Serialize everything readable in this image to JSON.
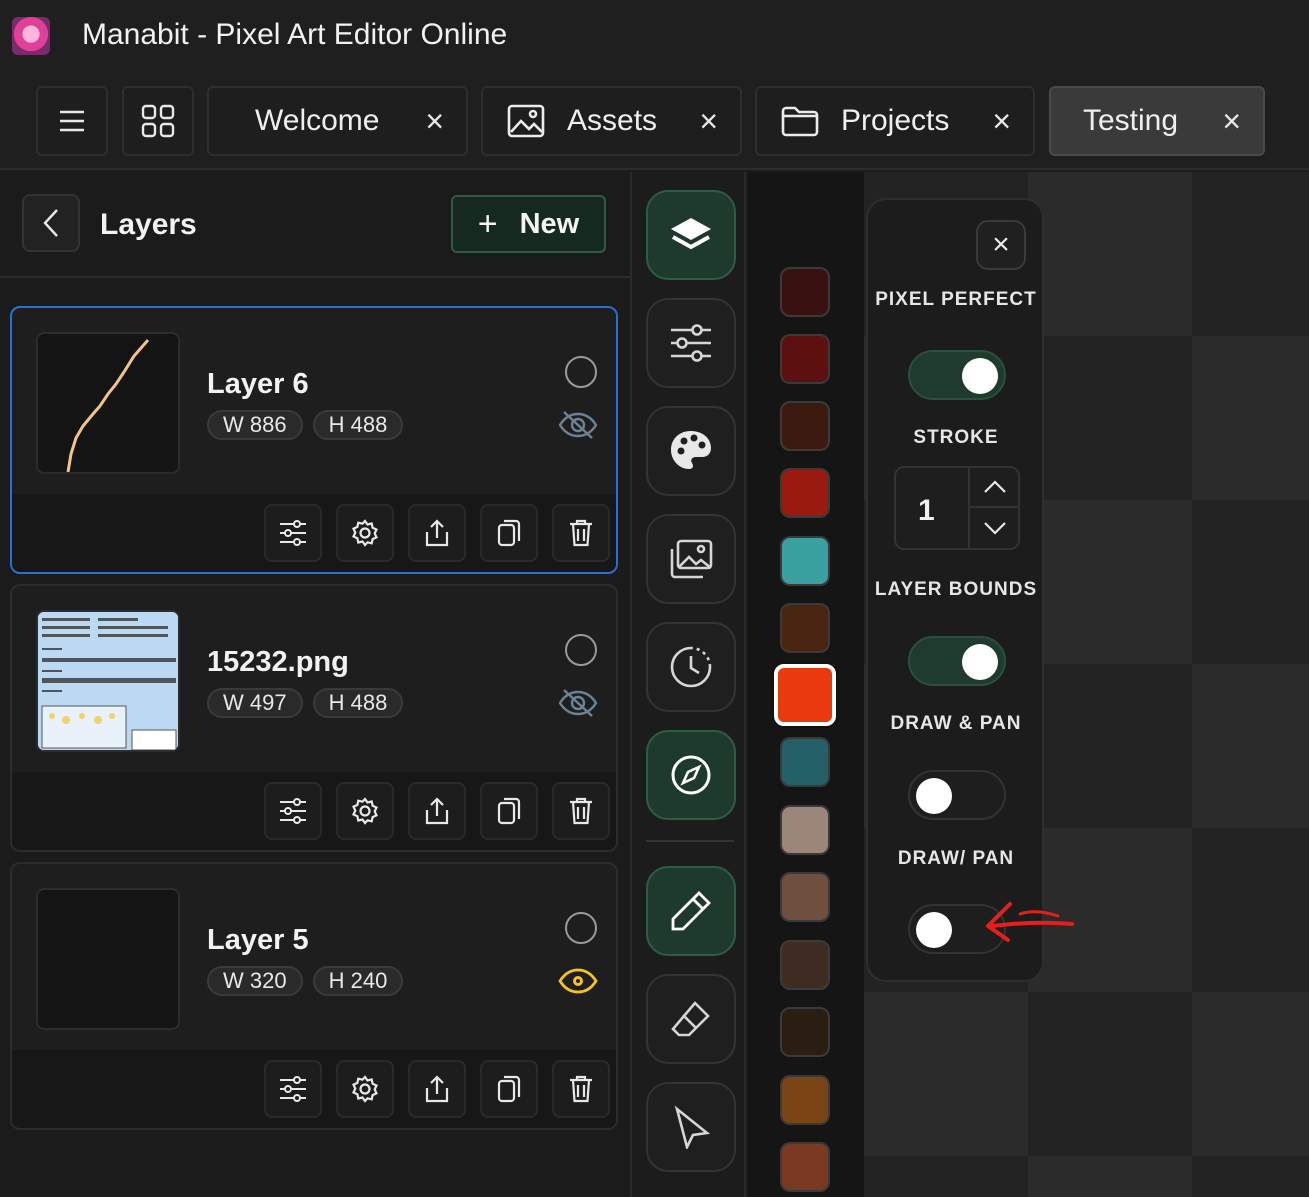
{
  "window": {
    "title": "Manabit - Pixel Art Editor Online"
  },
  "tabs": [
    {
      "label": "Welcome",
      "close": "×"
    },
    {
      "label": "Assets",
      "close": "×"
    },
    {
      "label": "Projects",
      "close": "×"
    },
    {
      "label": "Testing",
      "close": "×",
      "active": true
    }
  ],
  "layers_panel": {
    "title": "Layers",
    "new_button": {
      "plus": "+",
      "label": "New"
    },
    "layers": [
      {
        "name": "Layer 6",
        "width": "W 886",
        "height": "H 488",
        "visible": false,
        "selected": true
      },
      {
        "name": "15232.png",
        "width": "W 497",
        "height": "H 488",
        "visible": false,
        "selected": false
      },
      {
        "name": "Layer 5",
        "width": "W 320",
        "height": "H 240",
        "visible": true,
        "selected": false
      }
    ]
  },
  "tools": [
    "layers-icon",
    "sliders-icon",
    "palette-icon",
    "images-icon",
    "history-icon",
    "compass-icon",
    "pencil-icon",
    "eraser-icon",
    "pointer-icon"
  ],
  "palette_colors": [
    "#3a1111",
    "#5c1010",
    "#3d1a10",
    "#9a1a10",
    "#3aa0a0",
    "#4a2612",
    "#e8390f",
    "#246068",
    "#9c8679",
    "#6f5040",
    "#3e2c22",
    "#2a1e12",
    "#7a4414",
    "#7a3a22"
  ],
  "selected_color": "#e8390f",
  "options": {
    "close": "×",
    "pixel_perfect": {
      "label": "PIXEL PERFECT",
      "on": true
    },
    "stroke": {
      "label": "STROKE",
      "value": "1"
    },
    "layer_bounds": {
      "label": "LAYER BOUNDS",
      "on": true
    },
    "draw_pan": {
      "label": "DRAW & PAN",
      "on": false
    },
    "draw_slash_pan": {
      "label": "DRAW/ PAN",
      "on": false
    }
  }
}
